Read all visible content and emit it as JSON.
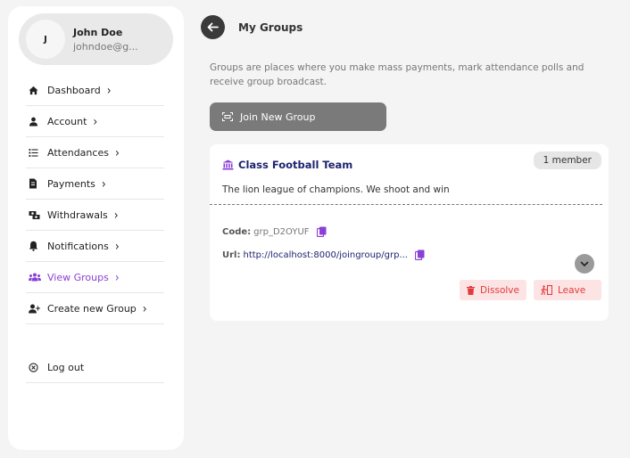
{
  "user": {
    "initial": "J",
    "name": "John Doe",
    "email": "johndoe@g..."
  },
  "sidebar": {
    "items": [
      {
        "label": "Dashboard",
        "icon": "home-icon"
      },
      {
        "label": "Account",
        "icon": "user-icon"
      },
      {
        "label": "Attendances",
        "icon": "list-icon"
      },
      {
        "label": "Payments",
        "icon": "receipt-icon"
      },
      {
        "label": "Withdrawals",
        "icon": "money-icon"
      },
      {
        "label": "Notifications",
        "icon": "bell-icon"
      },
      {
        "label": "View Groups",
        "icon": "users-icon",
        "active": true
      },
      {
        "label": "Create new Group",
        "icon": "user-plus-icon"
      }
    ],
    "logout_label": "Log out",
    "active_color": "#8a3fd6"
  },
  "header": {
    "title": "My Groups"
  },
  "description": "Groups are places where you make mass payments, mark attendance polls and receive group broadcast.",
  "join_button_label": "Join New Group",
  "group": {
    "name": "Class Football Team",
    "members_badge": "1 member",
    "description": "The lion league of champions. We shoot and win",
    "code_label": "Code:",
    "code_value": "grp_D2OYUF",
    "url_label": "Url:",
    "url_value": "http://localhost:8000/joingroup/grp...",
    "dissolve_label": "Dissolve",
    "leave_label": "Leave"
  }
}
